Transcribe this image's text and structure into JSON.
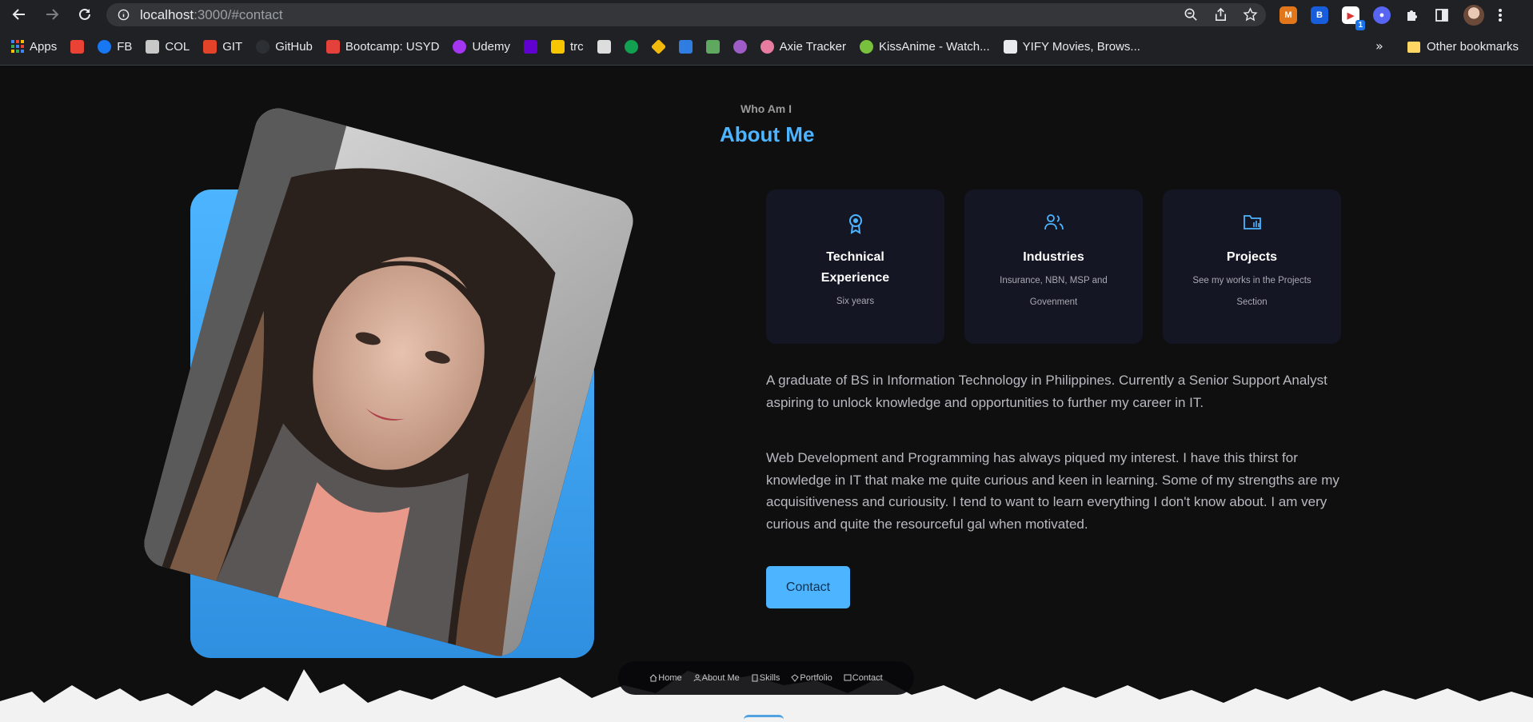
{
  "browser": {
    "url_host": "localhost",
    "url_path": ":3000/#contact",
    "bookmarks": [
      {
        "label": "Apps",
        "color": "#4285f4"
      },
      {
        "label": "",
        "color": "#ea4335"
      },
      {
        "label": "FB",
        "color": "#1877f2"
      },
      {
        "label": "COL",
        "color": "#c8c8c8"
      },
      {
        "label": "GIT",
        "color": "#e24329"
      },
      {
        "label": "GitHub",
        "color": "#24292e"
      },
      {
        "label": "Bootcamp: USYD",
        "color": "#e5413b"
      },
      {
        "label": "Udemy",
        "color": "#a435f0"
      },
      {
        "label": "",
        "color": "#6001d2"
      },
      {
        "label": "trc",
        "color": "#f7c600"
      },
      {
        "label": "",
        "color": "#dddddd"
      },
      {
        "label": "",
        "color": "#12a150"
      },
      {
        "label": "",
        "color": "#f0b90b"
      },
      {
        "label": "",
        "color": "#2f7de1"
      },
      {
        "label": "",
        "color": "#5fa85f"
      },
      {
        "label": "",
        "color": "#9e5cc6"
      },
      {
        "label": "Axie Tracker",
        "color": "#e77ca0"
      },
      {
        "label": "KissAnime - Watch...",
        "color": "#79c03c"
      },
      {
        "label": "YIFY Movies, Brows...",
        "color": "#e8eaed"
      }
    ],
    "more_bookmarks": "»",
    "other_bookmarks": "Other bookmarks",
    "extension_badge": "1"
  },
  "about": {
    "subtitle": "Who Am I",
    "title": "About Me",
    "cards": [
      {
        "icon": "award-icon",
        "title": "Technical Experience",
        "text": "Six years"
      },
      {
        "icon": "users-icon",
        "title": "Industries",
        "text": "Insurance, NBN, MSP and Govenment"
      },
      {
        "icon": "folder-icon",
        "title": "Projects",
        "text": "See my works in the Projects Section"
      }
    ],
    "bio_1": "A graduate of BS in Information Technology in Philippines. Currently a Senior Support Analyst aspiring to unlock knowledge and opportunities to further my career in IT.",
    "bio_2": "Web Development and Programming has always piqued my interest. I have this thirst for knowledge in IT that make me quite curious and keen in learning. Some of my strengths are my acquisitiveness and curiousity. I tend to want to learn everything I don't know about. I am very curious and quite the resourceful gal when motivated.",
    "contact_label": "Contact"
  },
  "dock": {
    "items": [
      {
        "icon": "home-icon",
        "label": "Home"
      },
      {
        "icon": "user-icon",
        "label": "About Me"
      },
      {
        "icon": "book-icon",
        "label": "Skills"
      },
      {
        "icon": "portfolio-icon",
        "label": "Portfolio"
      },
      {
        "icon": "message-icon",
        "label": "Contact"
      }
    ]
  },
  "colors": {
    "accent": "#4db5ff",
    "card_bg": "#141624",
    "page_bg": "#0f0f10"
  }
}
